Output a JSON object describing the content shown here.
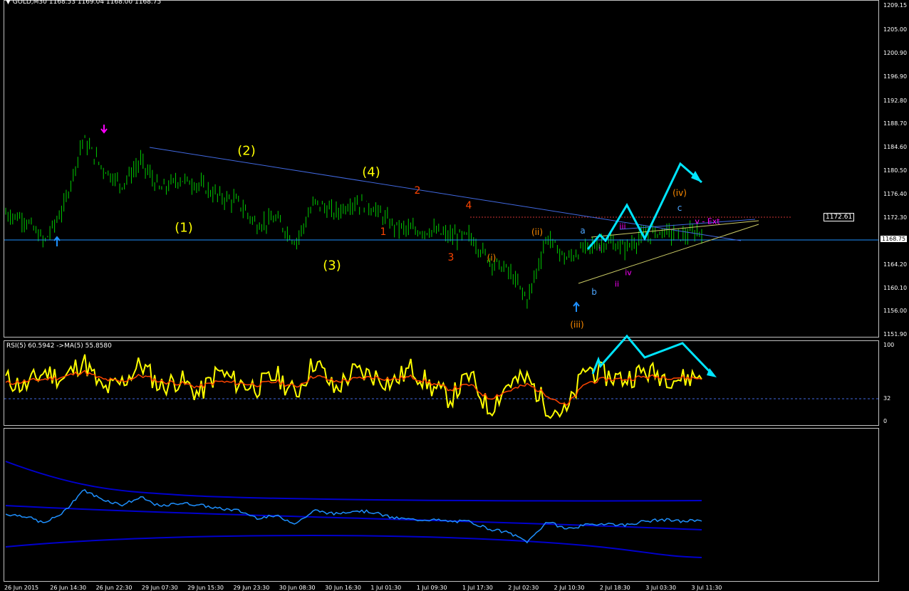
{
  "header": {
    "symbol": "GOLD,M30",
    "ohlc": "1168.53 1169.04 1168.00 1168.75",
    "rsi_label": "RSI(5) 60.5942 ->MA(5) 55.8580"
  },
  "price_axis": [
    "1209.15",
    "1205.00",
    "1200.90",
    "1196.90",
    "1192.80",
    "1188.70",
    "1184.60",
    "1180.50",
    "1176.40",
    "1172.30",
    "1168.75",
    "1164.20",
    "1160.10",
    "1156.00",
    "1151.90"
  ],
  "rsi_axis": [
    "100",
    "32",
    "0"
  ],
  "time_axis": [
    "26 Jun 2015",
    "26 Jun 14:30",
    "26 Jun 22:30",
    "29 Jun 07:30",
    "29 Jun 15:30",
    "29 Jun 23:30",
    "30 Jun 08:30",
    "30 Jun 16:30",
    "1 Jul 01:30",
    "1 Jul 09:30",
    "1 Jul 17:30",
    "2 Jul 02:30",
    "2 Jul 10:30",
    "2 Jul 18:30",
    "3 Jul 03:30",
    "3 Jul 11:30"
  ],
  "price_box": "1172.61",
  "current_price": "1168.75",
  "waves": [
    {
      "text": "(1)",
      "color": "#ffff00"
    },
    {
      "text": "(2)",
      "color": "#ffff00"
    },
    {
      "text": "(3)",
      "color": "#ffff00"
    },
    {
      "text": "(4)",
      "color": "#ffff00"
    },
    {
      "text": "1",
      "color": "#ff4500"
    },
    {
      "text": "2",
      "color": "#ff4500"
    },
    {
      "text": "3",
      "color": "#ff4500"
    },
    {
      "text": "4",
      "color": "#ff4500"
    },
    {
      "text": "(i)",
      "color": "#ff8c00"
    },
    {
      "text": "(ii)",
      "color": "#ff8c00"
    },
    {
      "text": "(iii)",
      "color": "#ff8c00"
    },
    {
      "text": "(iv)",
      "color": "#ff8c00"
    },
    {
      "text": "a",
      "color": "#4da6ff"
    },
    {
      "text": "b",
      "color": "#4da6ff"
    },
    {
      "text": "c",
      "color": "#4da6ff"
    },
    {
      "text": "i",
      "color": "#ff00ff"
    },
    {
      "text": "ii",
      "color": "#ff00ff"
    },
    {
      "text": "iii",
      "color": "#ff00ff"
    },
    {
      "text": "iv",
      "color": "#ff00ff"
    },
    {
      "text": "v - Ext",
      "color": "#ff00ff"
    }
  ],
  "colors": {
    "candles": "#00cc00",
    "rsi": "#ffff00",
    "rsi_ma": "#ff4500",
    "trend": "#4169e1",
    "projection": "#00e5ff",
    "envelope": "#0000cd",
    "mid_line": "#1e90ff"
  },
  "chart_data": {
    "type": "line",
    "title": "GOLD,M30",
    "series": [
      {
        "name": "GOLD,M30",
        "values": [
          1173,
          1172,
          1168,
          1174,
          1186,
          1181,
          1178,
          1182,
          1177,
          1179,
          1178,
          1176,
          1175,
          1171,
          1172,
          1168,
          1175,
          1173,
          1175,
          1174,
          1171,
          1170,
          1170,
          1169,
          1169,
          1165,
          1163,
          1158,
          1169,
          1165,
          1167,
          1168,
          1167,
          1169,
          1170,
          1169,
          1170
        ]
      },
      {
        "name": "RSI(5)",
        "values": [
          55,
          45,
          65,
          55,
          80,
          40,
          50,
          75,
          45,
          55,
          35,
          65,
          50,
          45,
          60,
          35,
          80,
          40,
          65,
          60,
          50,
          70,
          45,
          30,
          60,
          15,
          50,
          55,
          20,
          10,
          70,
          60,
          55,
          65,
          60,
          55,
          61
        ]
      },
      {
        "name": "MA(5)",
        "values": [
          50,
          52,
          55,
          58,
          65,
          55,
          52,
          60,
          52,
          50,
          45,
          52,
          50,
          48,
          52,
          45,
          60,
          52,
          55,
          58,
          55,
          58,
          50,
          42,
          48,
          30,
          40,
          48,
          35,
          20,
          50,
          55,
          55,
          58,
          58,
          57,
          56
        ]
      }
    ],
    "ylim": [
      1151.9,
      1211
    ],
    "grid": false
  }
}
